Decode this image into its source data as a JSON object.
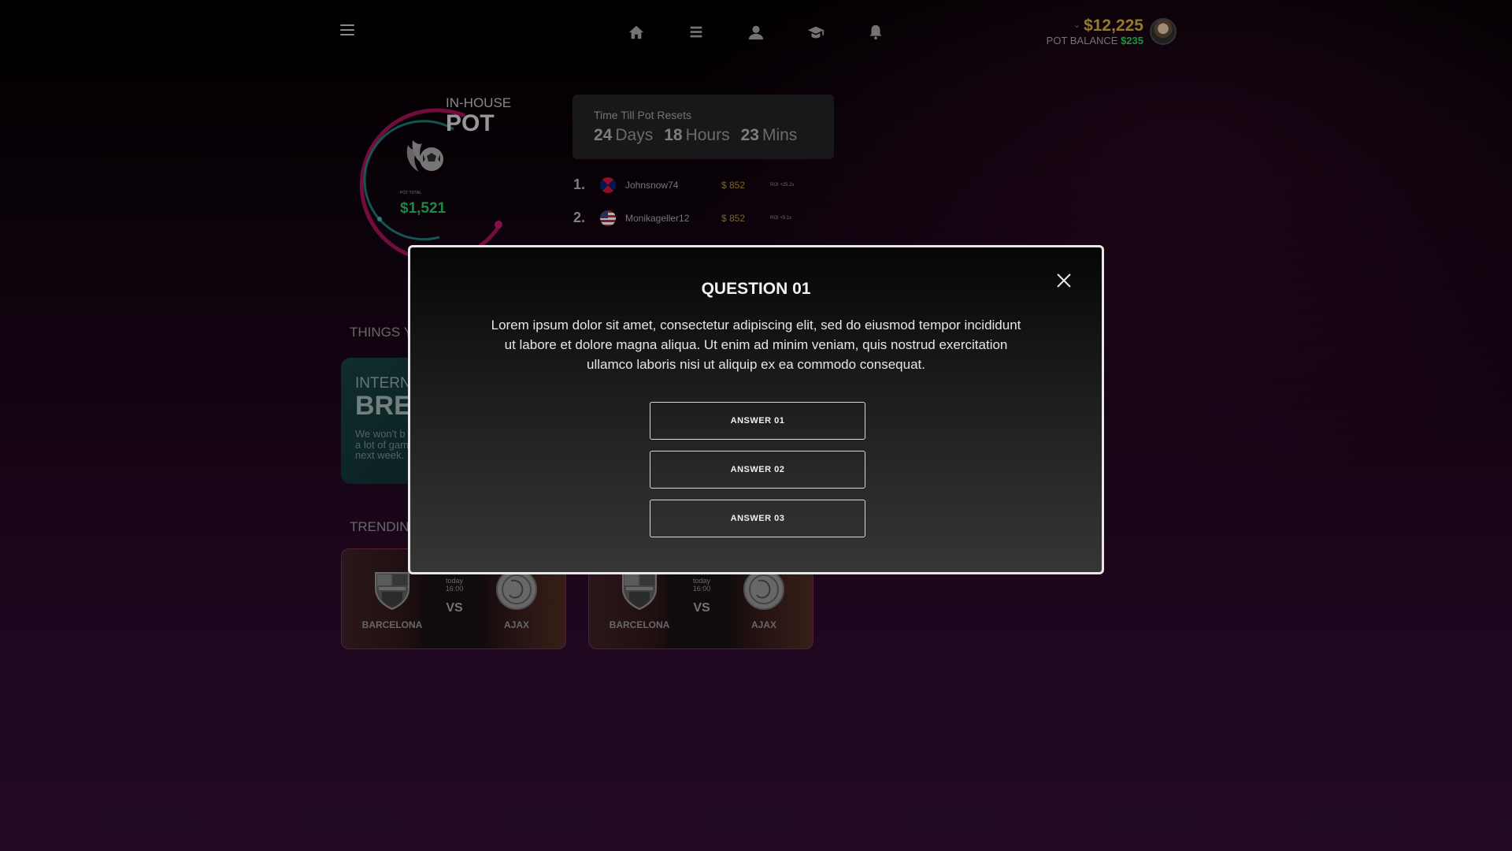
{
  "header": {
    "balance": "$12,225",
    "pot_balance_label": "POT BALANCE",
    "pot_balance_value": "$235",
    "nav": [
      "home-icon",
      "list-icon",
      "user-icon",
      "graduation-cap-icon",
      "bell-icon"
    ]
  },
  "pot": {
    "label_small": "IN-HOUSE",
    "label_big": "POT",
    "total_label": "POT TOTAL",
    "total": "$1,521"
  },
  "timer": {
    "label": "Time Till Pot Resets",
    "days": "24",
    "days_unit": "Days",
    "hours": "18",
    "hours_unit": "Hours",
    "mins": "23",
    "mins_unit": "Mins"
  },
  "leaderboard": [
    {
      "rank": "1.",
      "user": "Johnsnow74",
      "amount": "$ 852",
      "roi": "ROI +25.2x"
    },
    {
      "rank": "2.",
      "user": "Monikageller12",
      "amount": "$ 852",
      "roi": "ROI +5.1x"
    }
  ],
  "sections": {
    "things": "THINGS YO",
    "trending": "TRENDING"
  },
  "promo": {
    "small": "INTERN",
    "big": "BRE",
    "desc": "We won't b a lot of gam next week."
  },
  "matches": [
    {
      "home": "BARCELONA",
      "away": "AJAX",
      "day": "today",
      "time": "16:00",
      "vs": "VS"
    },
    {
      "home": "BARCELONA",
      "away": "AJAX",
      "day": "today",
      "time": "16:00",
      "vs": "VS"
    }
  ],
  "modal": {
    "title": "QUESTION 01",
    "body": "Lorem ipsum dolor sit amet, consectetur adipiscing elit, sed do eiusmod tempor incididunt ut labore et dolore magna aliqua. Ut enim ad minim veniam, quis nostrud exercitation ullamco laboris nisi ut aliquip ex ea commodo consequat.",
    "answers": [
      "ANSWER 01",
      "ANSWER 02",
      "ANSWER 03"
    ]
  },
  "colors": {
    "gold": "#c4a33d",
    "green": "#29c45b",
    "ring_magenta": "#b3145f",
    "ring_teal": "#1f8c86"
  }
}
